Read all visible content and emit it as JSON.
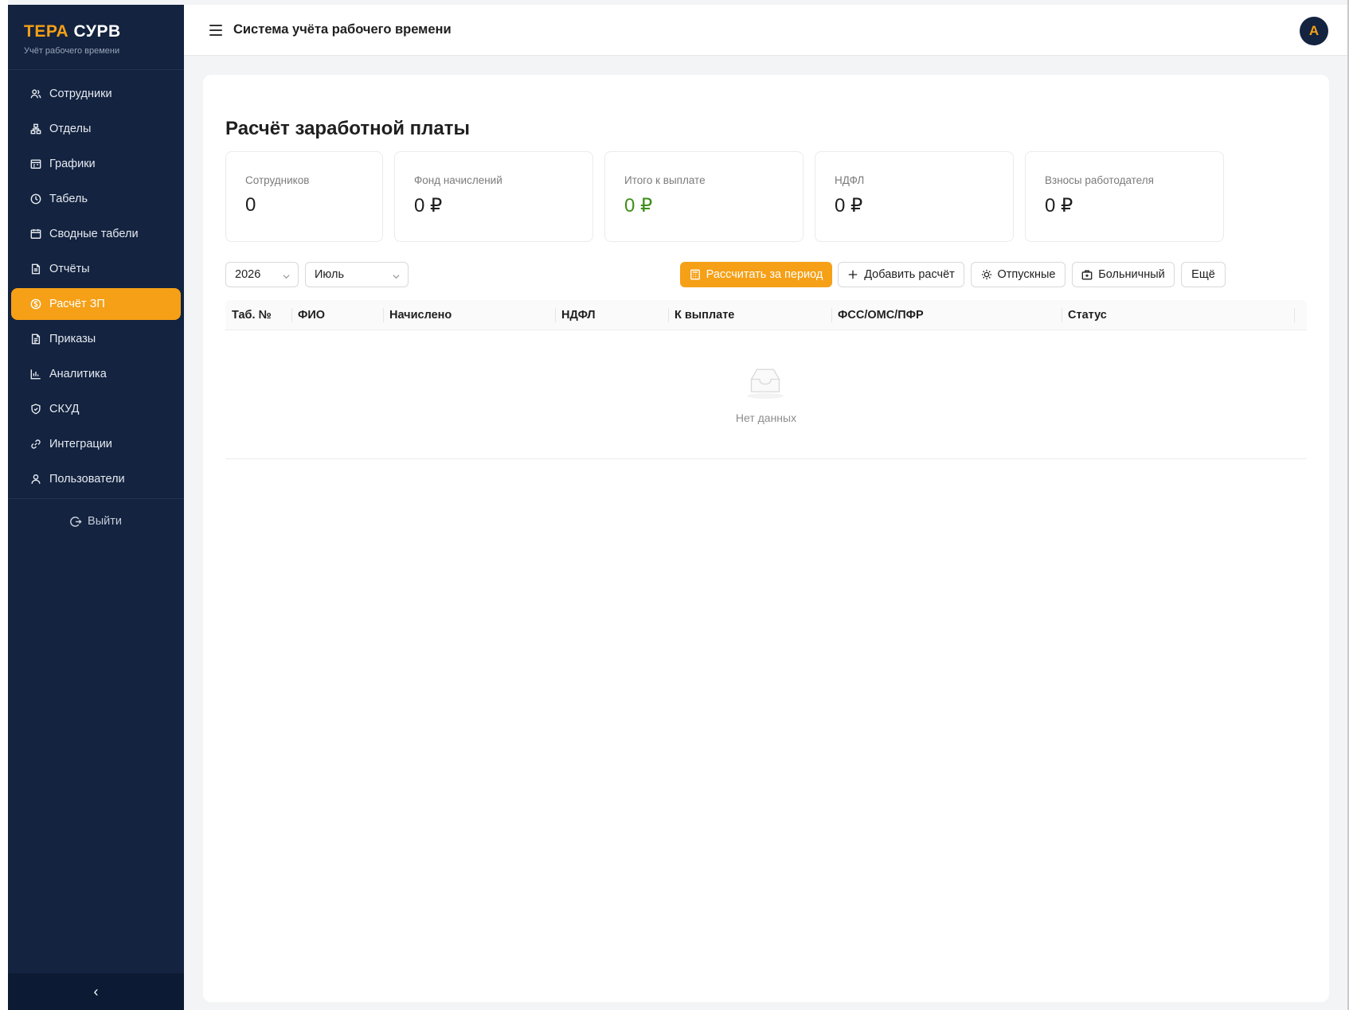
{
  "sidebar": {
    "logo_part1": "ТЕРА",
    "logo_part2": "СУРВ",
    "subtitle": "Учёт рабочего времени",
    "items": [
      {
        "label": "Сотрудники",
        "icon": "users-icon"
      },
      {
        "label": "Отделы",
        "icon": "org-chart-icon"
      },
      {
        "label": "Графики",
        "icon": "schedule-icon"
      },
      {
        "label": "Табель",
        "icon": "clock-icon"
      },
      {
        "label": "Сводные табели",
        "icon": "calendar-icon"
      },
      {
        "label": "Отчёты",
        "icon": "report-icon"
      },
      {
        "label": "Расчёт ЗП",
        "icon": "money-icon",
        "active": true
      },
      {
        "label": "Приказы",
        "icon": "document-icon"
      },
      {
        "label": "Аналитика",
        "icon": "bar-chart-icon"
      },
      {
        "label": "СКУД",
        "icon": "shield-icon"
      },
      {
        "label": "Интеграции",
        "icon": "link-icon"
      },
      {
        "label": "Пользователи",
        "icon": "user-icon"
      }
    ],
    "logout_label": "Выйти",
    "collapse_glyph": "‹"
  },
  "header": {
    "title": "Система учёта рабочего времени",
    "avatar_letter": "A"
  },
  "main": {
    "page_title": "Расчёт заработной платы",
    "stats": [
      {
        "label": "Сотрудников",
        "value": "0"
      },
      {
        "label": "Фонд начислений",
        "value": "0 ₽"
      },
      {
        "label": "Итого к выплате",
        "value": "0 ₽"
      },
      {
        "label": "НДФЛ",
        "value": "0 ₽"
      },
      {
        "label": "Взносы работодателя",
        "value": "0 ₽"
      }
    ],
    "filters": {
      "year": "2026",
      "month": "Июль"
    },
    "buttons": {
      "calculate": "Рассчитать за период",
      "add": "Добавить расчёт",
      "vacation": "Отпускные",
      "sick": "Больничный",
      "more": "Ещё"
    },
    "table": {
      "columns": [
        "Таб. №",
        "ФИО",
        "Начислено",
        "НДФЛ",
        "К выплате",
        "ФСС/ОМС/ПФР",
        "Статус"
      ],
      "rows": [],
      "empty_text": "Нет данных"
    }
  },
  "colors": {
    "sidebar_bg": "#132340",
    "accent": "#f5a017",
    "positive": "#3f8f1a"
  }
}
